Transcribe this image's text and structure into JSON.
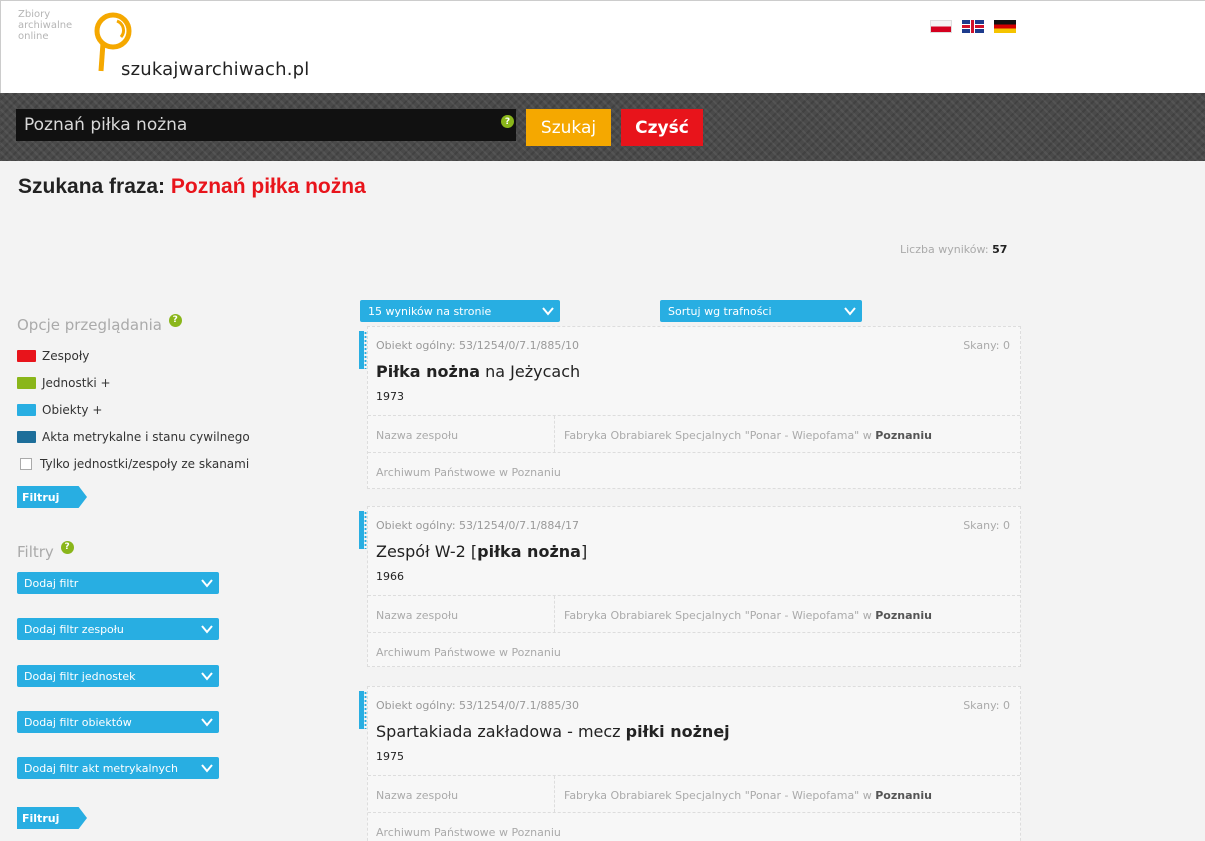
{
  "header": {
    "logo_small": [
      "Zbiory",
      "archiwalne",
      "online"
    ],
    "logo_text": "szukajwarchiwach.pl",
    "flags": [
      "pl",
      "en",
      "de"
    ]
  },
  "search": {
    "value": "Poznań piłka nożna",
    "help": "?",
    "search_label": "Szukaj",
    "clear_label": "Czyść"
  },
  "phrase": {
    "label": "Szukana fraza: ",
    "query": "Poznań piłka nożna"
  },
  "count": {
    "label": "Liczba wyników: ",
    "value": "57"
  },
  "sidebar": {
    "options_title": "Opcje przeglądania",
    "options": [
      {
        "label": "Zespoły",
        "color": "#e8141b"
      },
      {
        "label": "Jednostki +",
        "color": "#8ab61a"
      },
      {
        "label": "Obiekty +",
        "color": "#28aee2"
      },
      {
        "label": "Akta metrykalne i stanu cywilnego",
        "color": "#1d6e9a"
      }
    ],
    "scans_only_label": "Tylko jednostki/zespoły ze skanami",
    "filter_button": "Filtruj",
    "filters_title": "Filtry",
    "filter_dropdowns": [
      "Dodaj filtr",
      "Dodaj filtr zespołu",
      "Dodaj filtr jednostek",
      "Dodaj filtr obiektów",
      "Dodaj filtr akt metrykalnych"
    ],
    "filter_button_2": "Filtruj"
  },
  "results": {
    "per_page": "15 wyników na stronie",
    "sort": "Sortuj wg trafności",
    "items": [
      {
        "id": "Obiekt ogólny: 53/1254/0/7.1/885/10",
        "scans": "Skany: 0",
        "title_parts": [
          {
            "text": "Piłka nożna",
            "bold": true
          },
          {
            "text": " na Jeżycach",
            "bold": false
          }
        ],
        "year": "1973",
        "fond_label": "Nazwa zespołu",
        "fond_value": "Fabryka Obrabiarek Specjalnych \"Ponar - Wiepofama\" w ",
        "fond_city": "Poznaniu",
        "archive": "Archiwum Państwowe w Poznaniu"
      },
      {
        "id": "Obiekt ogólny: 53/1254/0/7.1/884/17",
        "scans": "Skany: 0",
        "title_parts": [
          {
            "text": "Zespół W-2 [",
            "bold": false
          },
          {
            "text": "piłka nożna",
            "bold": true
          },
          {
            "text": "]",
            "bold": false
          }
        ],
        "year": "1966",
        "fond_label": "Nazwa zespołu",
        "fond_value": "Fabryka Obrabiarek Specjalnych \"Ponar - Wiepofama\" w ",
        "fond_city": "Poznaniu",
        "archive": "Archiwum Państwowe w Poznaniu"
      },
      {
        "id": "Obiekt ogólny: 53/1254/0/7.1/885/30",
        "scans": "Skany: 0",
        "title_parts": [
          {
            "text": "Spartakiada zakładowa - mecz ",
            "bold": false
          },
          {
            "text": "piłki nożnej",
            "bold": true
          }
        ],
        "year": "1975",
        "fond_label": "Nazwa zespołu",
        "fond_value": "Fabryka Obrabiarek Specjalnych \"Ponar - Wiepofama\" w ",
        "fond_city": "Poznaniu",
        "archive": "Archiwum Państwowe w Poznaniu"
      }
    ]
  }
}
